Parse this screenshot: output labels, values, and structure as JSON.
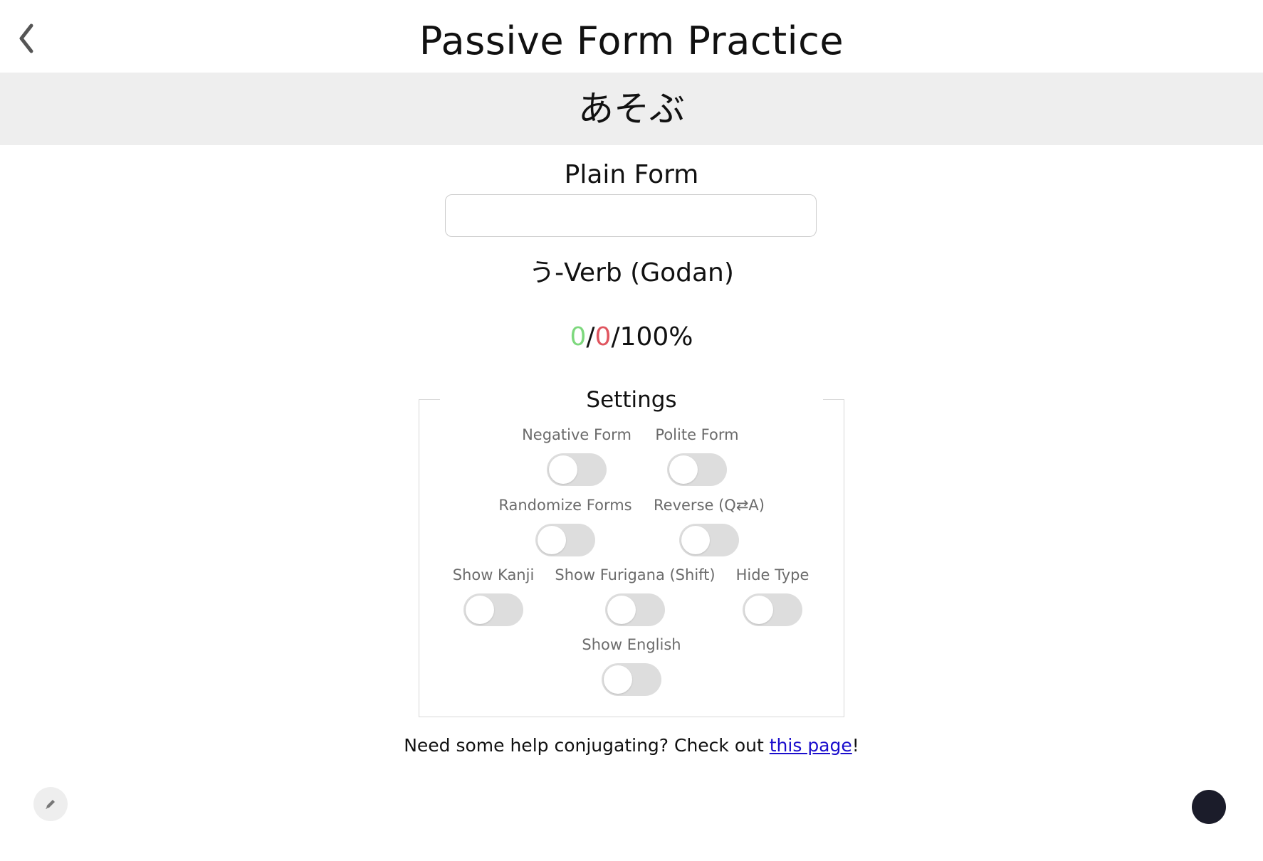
{
  "header": {
    "title": "Passive Form Practice",
    "back_icon": "chevron-left-icon"
  },
  "prompt": {
    "word": "あそぶ"
  },
  "answer": {
    "label": "Plain Form",
    "value": "",
    "placeholder": ""
  },
  "verb_type": "う-Verb (Godan)",
  "score": {
    "correct": "0",
    "wrong": "0",
    "percent": "100%",
    "separator": "/",
    "colors": {
      "correct": "#7dd87d",
      "wrong": "#e0555f"
    }
  },
  "settings": {
    "title": "Settings",
    "options": [
      {
        "label": "Negative Form",
        "on": false
      },
      {
        "label": "Polite Form",
        "on": false
      },
      {
        "label": "Randomize Forms",
        "on": false
      },
      {
        "label": "Reverse (Q⇄A)",
        "on": false
      },
      {
        "label": "Show Kanji",
        "on": false
      },
      {
        "label": "Show Furigana (Shift)",
        "on": false
      },
      {
        "label": "Hide Type",
        "on": false
      },
      {
        "label": "Show English",
        "on": false
      }
    ]
  },
  "help": {
    "prefix": "Need some help conjugating? Check out ",
    "link_text": "this page",
    "suffix": "!"
  },
  "fabs": {
    "edit_icon": "pencil-icon",
    "dark_button_color": "#1b1c2a"
  }
}
